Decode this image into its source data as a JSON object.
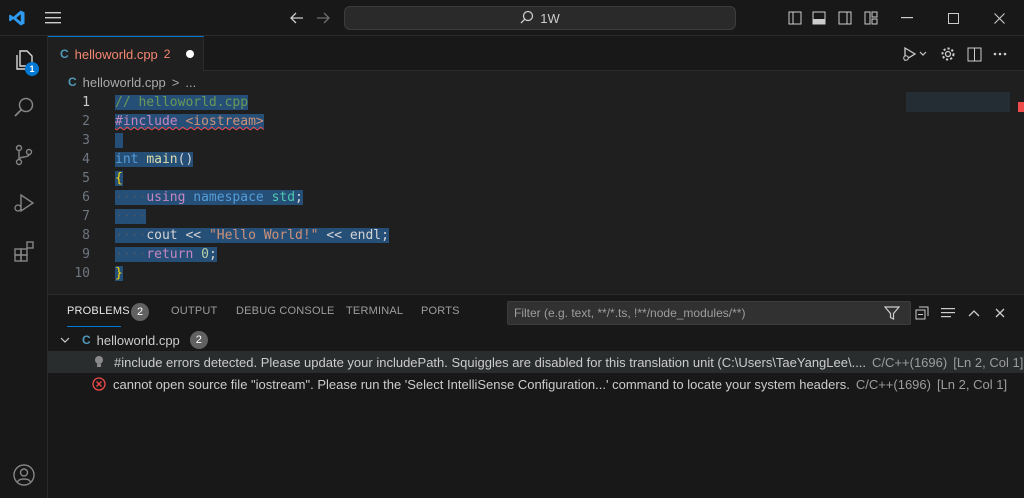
{
  "titlebar": {
    "search_text": "1W"
  },
  "activity": {
    "explorer_badge": "1"
  },
  "tab": {
    "file_icon": "C",
    "filename": "helloworld.cpp",
    "problem_count": "2"
  },
  "breadcrumb": {
    "file": "helloworld.cpp",
    "separator": ">",
    "more": "..."
  },
  "code": {
    "line_numbers": [
      "1",
      "2",
      "3",
      "4",
      "5",
      "6",
      "7",
      "8",
      "9",
      "10"
    ]
  },
  "panel": {
    "tabs": {
      "problems": "PROBLEMS",
      "problems_count": "2",
      "output": "OUTPUT",
      "debug_console": "DEBUG CONSOLE",
      "terminal": "TERMINAL",
      "ports": "PORTS"
    },
    "filter_placeholder": "Filter (e.g. text, **/*.ts, !**/node_modules/**)",
    "file_group": {
      "filename": "helloworld.cpp",
      "count": "2"
    },
    "problems": [
      {
        "message": "#include errors detected. Please update your includePath. Squiggles are disabled for this translation unit (C:\\Users\\TaeYangLee\\....",
        "source": "C/C++(1696)",
        "location": "[Ln 2, Col 1]"
      },
      {
        "message": "cannot open source file \"iostream\". Please run the 'Select IntelliSense Configuration...' command to locate your system headers.",
        "source": "C/C++(1696)",
        "location": "[Ln 2, Col 1]"
      }
    ]
  },
  "colors": {
    "accent": "#0078d4",
    "error": "#f14c4c",
    "selection": "#264f78"
  }
}
